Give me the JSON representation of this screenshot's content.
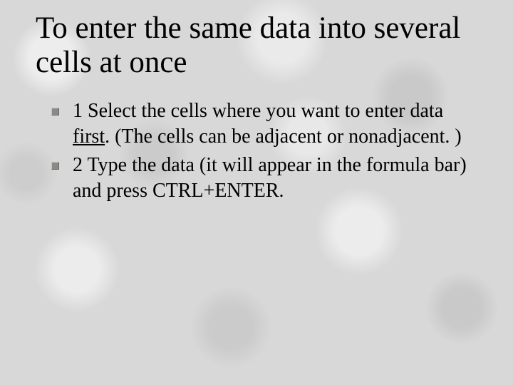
{
  "title": "To enter the same data into several cells at once",
  "bullets": [
    {
      "pre": "1 Select the cells where you want to enter data ",
      "u": "first",
      "post": ". (The cells can be adjacent or nonadjacent. )"
    },
    {
      "pre": "2 Type the data (it will appear in the formula bar) and press CTRL+ENTER.",
      "u": "",
      "post": ""
    }
  ]
}
